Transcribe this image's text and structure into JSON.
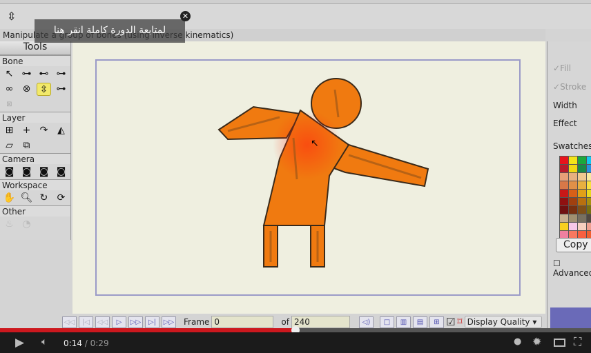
{
  "status_text": "Manipulate a group of bones (using inverse kinematics)",
  "overlay": {
    "text": "لمتابعة الدورة كاملة انقر هنا",
    "close": "✕"
  },
  "tools": {
    "title": "Tools",
    "sections": [
      "Bone",
      "Layer",
      "Camera",
      "Workspace",
      "Other"
    ]
  },
  "right_panel": {
    "fill": "Fill",
    "stroke": "Stroke",
    "width": "Width",
    "effect": "Effect",
    "swatches": "Swatches",
    "copy": "Copy",
    "advanced": "Advanced",
    "swatch_colors": [
      "#e8141c",
      "#f2e418",
      "#1ca83c",
      "#14c8f0",
      "#b81c2c",
      "#f0d814",
      "#188a48",
      "#2890e0",
      "#e8a078",
      "#e8b080",
      "#f0c890",
      "#f8e8a0",
      "#d87848",
      "#e09048",
      "#e8b040",
      "#f8e040",
      "#c81818",
      "#d86018",
      "#e0a018",
      "#e8d820",
      "#901010",
      "#a04010",
      "#b87010",
      "#a89010",
      "#701010",
      "#783010",
      "#805018",
      "#787010",
      "#c8b090",
      "#a09070",
      "#787060",
      "#504840",
      "#f8d020",
      "#f8c8e8",
      "#f8d0c0",
      "#f0a090",
      "#f080a0",
      "#f87860",
      "#f86040",
      "#f06030"
    ]
  },
  "timeline": {
    "frame_label": "Frame",
    "frame_value": "0",
    "of_label": "of",
    "total_frames": "240",
    "display_quality": "Display Quality"
  },
  "player": {
    "current_time": "0:14",
    "separator": " / ",
    "duration": "0:29",
    "progress_fraction": 0.5
  }
}
